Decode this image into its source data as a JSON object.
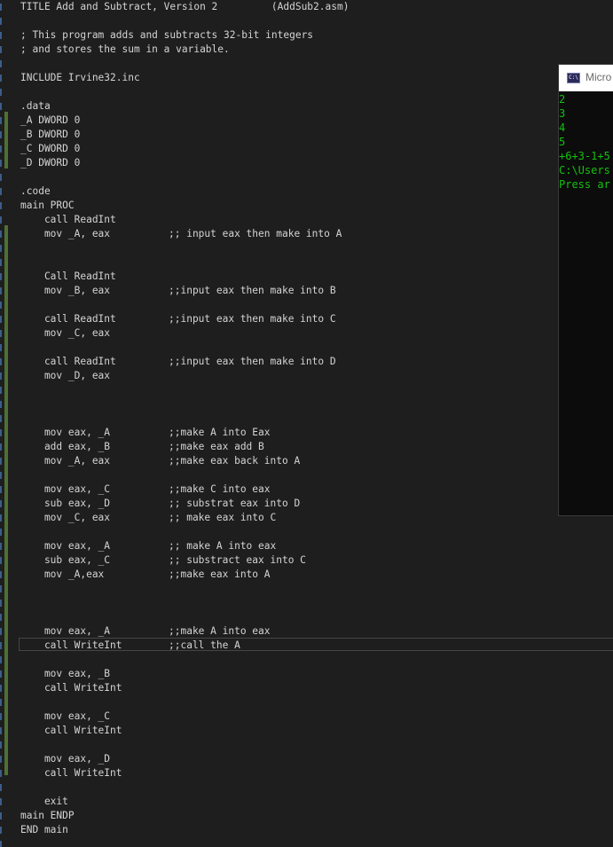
{
  "editor": {
    "lines": [
      {
        "code": "TITLE Add and Subtract, Version 2         (AddSub2.asm)",
        "comment": ""
      },
      {
        "code": "",
        "comment": ""
      },
      {
        "code": "; This program adds and subtracts 32-bit integers",
        "comment": ""
      },
      {
        "code": "; and stores the sum in a variable.",
        "comment": ""
      },
      {
        "code": "",
        "comment": ""
      },
      {
        "code": "INCLUDE Irvine32.inc",
        "comment": ""
      },
      {
        "code": "",
        "comment": ""
      },
      {
        "code": ".data",
        "comment": ""
      },
      {
        "code": "_A DWORD 0",
        "comment": ""
      },
      {
        "code": "_B DWORD 0",
        "comment": ""
      },
      {
        "code": "_C DWORD 0",
        "comment": ""
      },
      {
        "code": "_D DWORD 0",
        "comment": ""
      },
      {
        "code": "",
        "comment": ""
      },
      {
        "code": ".code",
        "comment": ""
      },
      {
        "code": "main PROC",
        "comment": ""
      },
      {
        "code": "    call ReadInt",
        "comment": ""
      },
      {
        "code": "    mov _A, eax",
        "comment": ";; input eax then make into A"
      },
      {
        "code": "",
        "comment": ""
      },
      {
        "code": "",
        "comment": ""
      },
      {
        "code": "    Call ReadInt",
        "comment": ""
      },
      {
        "code": "    mov _B, eax",
        "comment": ";;input eax then make into B"
      },
      {
        "code": "",
        "comment": ""
      },
      {
        "code": "    call ReadInt",
        "comment": ";;input eax then make into C"
      },
      {
        "code": "    mov _C, eax",
        "comment": ""
      },
      {
        "code": "",
        "comment": ""
      },
      {
        "code": "    call ReadInt",
        "comment": ";;input eax then make into D"
      },
      {
        "code": "    mov _D, eax",
        "comment": ""
      },
      {
        "code": "",
        "comment": ""
      },
      {
        "code": "",
        "comment": ""
      },
      {
        "code": "",
        "comment": ""
      },
      {
        "code": "    mov eax, _A",
        "comment": ";;make A into Eax"
      },
      {
        "code": "    add eax, _B",
        "comment": ";;make eax add B"
      },
      {
        "code": "    mov _A, eax",
        "comment": ";;make eax back into A"
      },
      {
        "code": "",
        "comment": ""
      },
      {
        "code": "    mov eax, _C",
        "comment": ";;make C into eax"
      },
      {
        "code": "    sub eax, _D",
        "comment": ";; substrat eax into D"
      },
      {
        "code": "    mov _C, eax",
        "comment": ";; make eax into C"
      },
      {
        "code": "",
        "comment": ""
      },
      {
        "code": "    mov eax, _A",
        "comment": ";; make A into eax"
      },
      {
        "code": "    sub eax, _C",
        "comment": ";; substract eax into C"
      },
      {
        "code": "    mov _A,eax",
        "comment": ";;make eax into A"
      },
      {
        "code": "",
        "comment": ""
      },
      {
        "code": "",
        "comment": ""
      },
      {
        "code": "",
        "comment": ""
      },
      {
        "code": "    mov eax, _A",
        "comment": ";;make A into eax"
      },
      {
        "code": "    call WriteInt",
        "comment": ";;call the A"
      },
      {
        "code": "",
        "comment": ""
      },
      {
        "code": "    mov eax, _B",
        "comment": ""
      },
      {
        "code": "    call WriteInt",
        "comment": ""
      },
      {
        "code": "",
        "comment": ""
      },
      {
        "code": "    mov eax, _C",
        "comment": ""
      },
      {
        "code": "    call WriteInt",
        "comment": ""
      },
      {
        "code": "",
        "comment": ""
      },
      {
        "code": "    mov eax, _D",
        "comment": ""
      },
      {
        "code": "    call WriteInt",
        "comment": ""
      },
      {
        "code": "",
        "comment": ""
      },
      {
        "code": "    exit",
        "comment": ""
      },
      {
        "code": "main ENDP",
        "comment": ""
      },
      {
        "code": "END main",
        "comment": ""
      }
    ]
  },
  "console": {
    "title": "Micro",
    "icon": "console-app-icon",
    "output": [
      "2",
      "3",
      "4",
      "5",
      "+6+3-1+5",
      "C:\\Users",
      "Press ar"
    ],
    "text_color": "#13c10e",
    "background": "#0c0c0c"
  },
  "colors": {
    "editor_background": "#1e1e1e",
    "code_text": "#d4d4d4",
    "change_marker": "#4e6f35"
  }
}
